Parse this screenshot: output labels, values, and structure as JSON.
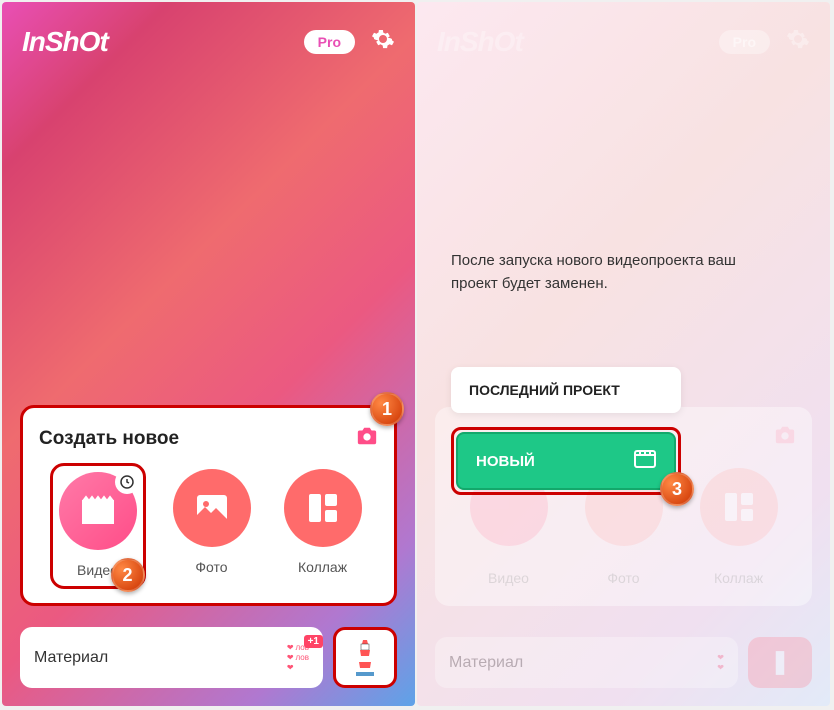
{
  "app_name": "InShOt",
  "pro_label": "Pro",
  "left": {
    "create_title": "Создать новое",
    "actions": {
      "video": "Видео",
      "photo": "Фото",
      "collage": "Коллаж"
    },
    "material_label": "Материал",
    "heart_text": "лов",
    "plus_badge": "+1",
    "badges": {
      "one": "1",
      "two": "2"
    }
  },
  "right": {
    "dialog_text": "После запуска нового видеопроекта ваш проект будет заменен.",
    "last_project": "ПОСЛЕДНИЙ ПРОЕКТ",
    "new_btn": "НОВЫЙ",
    "faded_actions": {
      "video": "Видео",
      "photo": "Фото",
      "collage": "Коллаж"
    },
    "material_label": "Материал",
    "badges": {
      "three": "3"
    }
  },
  "colors": {
    "accent_red": "#cc0000",
    "green": "#1ec887",
    "coral": "#ff6b6b"
  }
}
